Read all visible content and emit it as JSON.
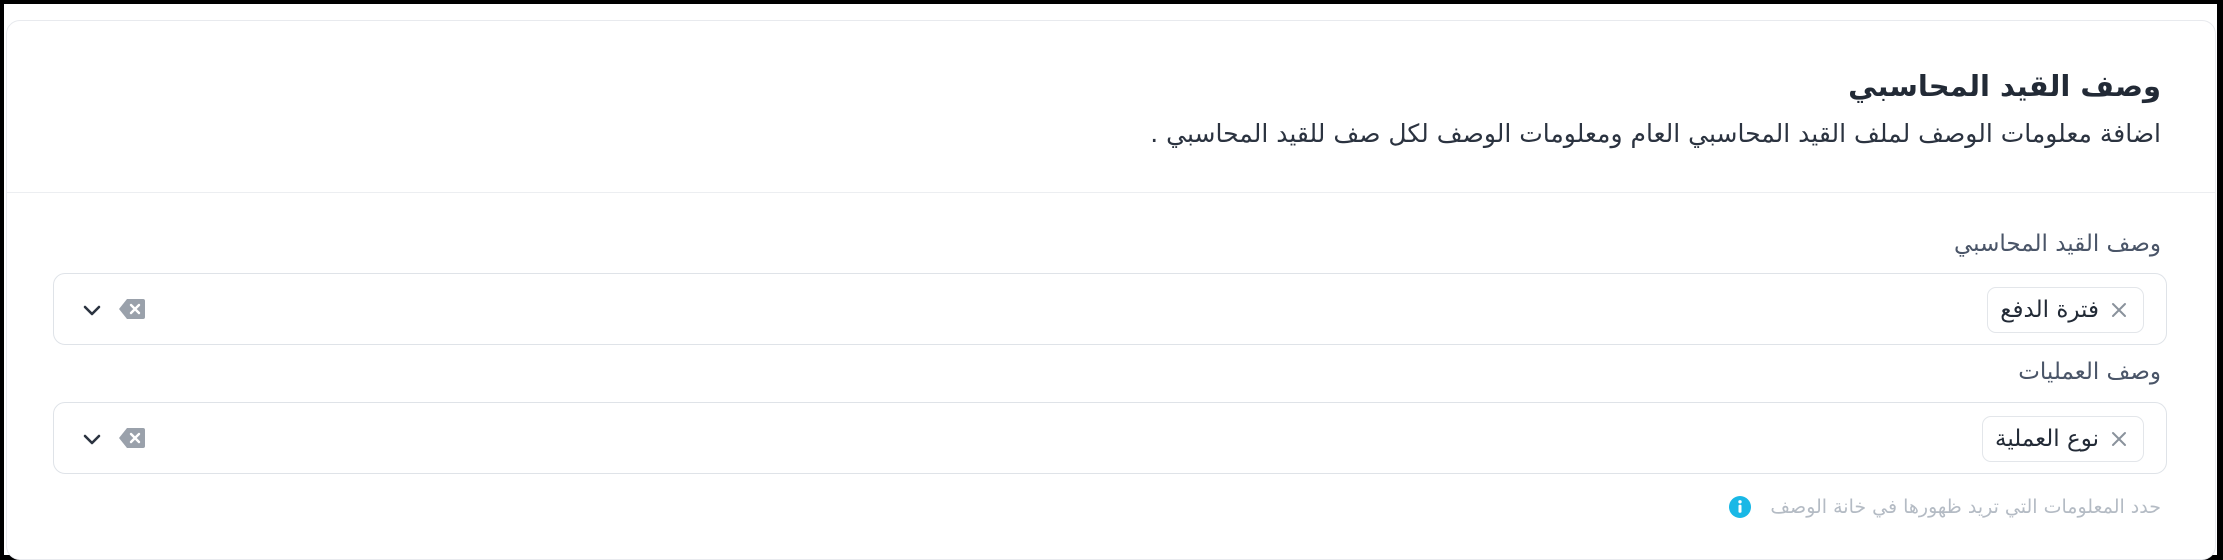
{
  "card": {
    "title": "وصف القيد المحاسبي",
    "subtitle": "اضافة معلومات الوصف لملف القيد المحاسبي العام ومعلومات الوصف لكل صف للقيد المحاسبي ."
  },
  "fields": {
    "entry_description": {
      "label": "وصف القيد المحاسبي",
      "selected": [
        {
          "label": "فترة الدفع"
        }
      ]
    },
    "operations_description": {
      "label": "وصف العمليات",
      "selected": [
        {
          "label": "نوع العملية"
        }
      ]
    }
  },
  "hint": {
    "text": "حدد المعلومات التي تريد ظهورها في خانة الوصف",
    "icon": "info-icon"
  },
  "colors": {
    "accent": "#19b8e6",
    "border": "#dfe3e8",
    "title_text": "#222a36",
    "muted_text": "#b4bbc4",
    "clear_icon": "#9aa1ab"
  }
}
